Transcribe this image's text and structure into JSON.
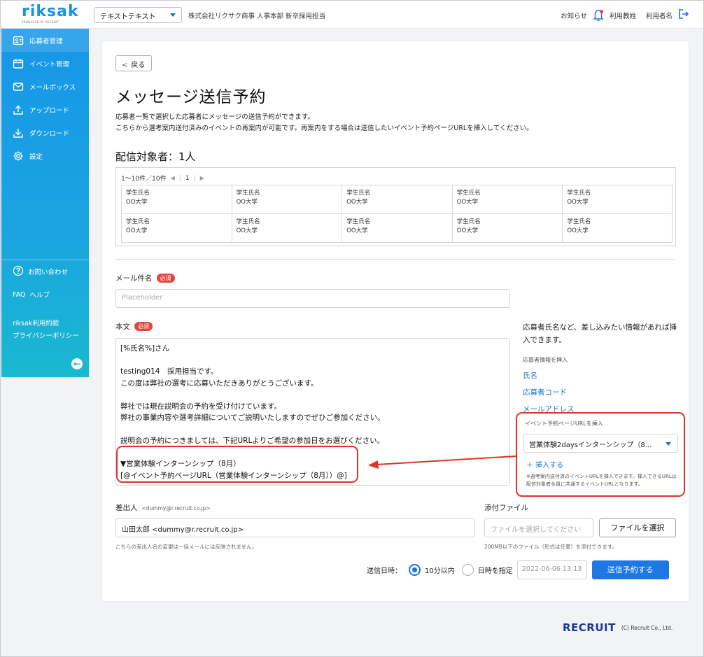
{
  "header": {
    "logo": "riksak",
    "logo_sub": "PRODUCED BY RECRUIT",
    "company_select": "テキストテキスト",
    "org_name": "株式会社リクサク商事 人事本部 新卒採用担当",
    "notice": "お知らせ",
    "user_role": "利用教姓",
    "user_name": "利用者名"
  },
  "sidebar": {
    "items": [
      {
        "label": "応募者管理",
        "icon": "id-card-icon"
      },
      {
        "label": "イベント管理",
        "icon": "calendar-icon"
      },
      {
        "label": "メールボックス",
        "icon": "mail-icon"
      },
      {
        "label": "アップロード",
        "icon": "upload-icon"
      },
      {
        "label": "ダウンロード",
        "icon": "download-icon"
      },
      {
        "label": "設定",
        "icon": "gear-icon"
      }
    ],
    "contact": "お問い合わせ",
    "faq": "FAQ",
    "help": "ヘルプ",
    "terms": "riksak利用約款",
    "privacy": "プライバシーポリシー"
  },
  "page": {
    "back": "戻る",
    "title": "メッセージ送信予約",
    "desc_line1": "応募者一覧で選択した応募者にメッセージの送信予約ができます。",
    "desc_line2": "こちらから選考案内送付済みのイベントの再案内が可能です。再案内をする場合は送信したいイベント予約ページURLを挿入してください。",
    "recipients_title": "配信対象者：1人",
    "pager_range": "1〜10件／10件",
    "pager_page": "1",
    "recipients": [
      {
        "name": "学生氏名",
        "school": "OO大学"
      },
      {
        "name": "学生氏名",
        "school": "OO大学"
      },
      {
        "name": "学生氏名",
        "school": "OO大学"
      },
      {
        "name": "学生氏名",
        "school": "OO大学"
      },
      {
        "name": "学生氏名",
        "school": "OO大学"
      },
      {
        "name": "学生氏名",
        "school": "OO大学"
      },
      {
        "name": "学生氏名",
        "school": "OO大学"
      },
      {
        "name": "学生氏名",
        "school": "OO大学"
      },
      {
        "name": "学生氏名",
        "school": "OO大学"
      },
      {
        "name": "学生氏名",
        "school": "OO大学"
      }
    ]
  },
  "form": {
    "subject_label": "メール件名",
    "required": "必須",
    "subject_placeholder": "Placeholder",
    "body_label": "本文",
    "body_text": "[%氏名%]さん\n\ntesting014　採用担当です。\nこの度は弊社の選考に応募いただきありがとうございます。\n\n弊社では現在説明会の予約を受け付けています。\n弊社の事業内容や選考詳細についてご説明いたしますのでぜひご参加ください。\n\n説明会の予約につきましては、下記URLよりご希望の参加日をお選びください。\n\n▼営業体験インターンシップ（8月）\n[@イベント予約ページURL（営業体験インターンシップ（8月））@]",
    "side_help": "応募者氏名など、差し込みたい情報があれば挿入できます。",
    "insert_caption": "応募者情報を挿入",
    "insert_links": [
      "氏名",
      "応募者コード",
      "メールアドレス"
    ],
    "event_caption": "イベント予約ページURLを挿入",
    "event_selected": "営業体験2daysインターンシップ（8...",
    "event_insert": "＋ 挿入する",
    "event_note": "※選考案内送付済のイベントURLを挿入できます。挿入できるURLは配信対象者全員に共通するイベントURLとなります。",
    "sender_label": "差出人",
    "sender_sub": "<dummy@r.recruit.co.jp>",
    "sender_value": "山田太郎 <dummy@r.recruit.co.jp>",
    "sender_note": "こちらの差出人名の変更は一括メールには反映されません。",
    "attach_label": "添付ファイル",
    "attach_placeholder": "ファイルを選択してください",
    "attach_button": "ファイルを選択",
    "attach_note": "200MB以下のファイル（形式は任意）を添付できます。",
    "send_time_label": "送信日時：",
    "option_within": "10分以内",
    "option_specify": "日時を指定",
    "date_placeholder": "2022-06-06 13:13",
    "send_button": "送信予約する"
  },
  "footer": {
    "brand": "RECRUIT",
    "copyright": "(C) Recruit Co., Ltd."
  },
  "colors": {
    "accent": "#1d78e6",
    "highlight": "#e0322b",
    "required": "#e8433f"
  }
}
